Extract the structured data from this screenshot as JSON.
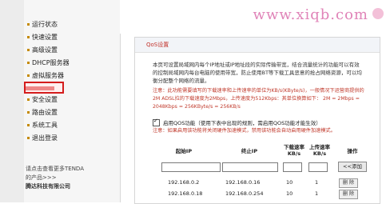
{
  "sidebar": {
    "items": [
      {
        "label": "运行状态"
      },
      {
        "label": "快速设置"
      },
      {
        "label": "高级设置"
      },
      {
        "label": "DHCP服务器"
      },
      {
        "label": "虚拟服务器"
      },
      {
        "label": ""
      },
      {
        "label": "安全设置"
      },
      {
        "label": "路由设置"
      },
      {
        "label": "系统工具"
      },
      {
        "label": "退出登录"
      }
    ],
    "footer_line1": "请点击查看更多TENDA",
    "footer_line2": "的产品>>>",
    "company": "腾达科技有限公司"
  },
  "header": {
    "watermark": "www.xiqb.com"
  },
  "panel": {
    "title": "QoS设置",
    "description": "本页可设置局域网内每个IP地址或IP地址段的实际传输带宽，结合流量统计的功能可以有效的控制局域网内每台电脑的使用带宽，防止使用BT等下载工具恶意的抢占网络资源，可以均衡分配整个网络的流量。",
    "note": "注意：此功能需要填写的下载速率和上传速率的单位为KB/s(KByte/s)，一般情况下运营商提供的2M ADSL拉的下载速度为2Mbps，上传速度为512Kbps：其单位换算如下：  2M = 2Mbps = 2048Kbps = 256KByte/s = 256KB/s",
    "enable_label": "启用QOS功能（使用下表中出现的规则，需启用QOS功能才能生效）",
    "enable_checked": true,
    "note2": "注意：如果启用该功能将关闭硬件加速模式，禁用该功能会自动启用硬件加速模式。",
    "columns": {
      "start_ip": "起始IP",
      "end_ip": "终止IP",
      "down_rate": "下载速率",
      "up_rate": "上传速率",
      "unit": "KB/s",
      "op": "操作"
    },
    "add_button": "<<添加",
    "rows": [
      {
        "start": "192.168.0.2",
        "end": "192.168.0.16",
        "down": "10",
        "up": "1",
        "action": "删 除"
      },
      {
        "start": "192.168.0.18",
        "end": "192.168.0.254",
        "down": "10",
        "up": "1",
        "action": "删 除"
      }
    ]
  }
}
